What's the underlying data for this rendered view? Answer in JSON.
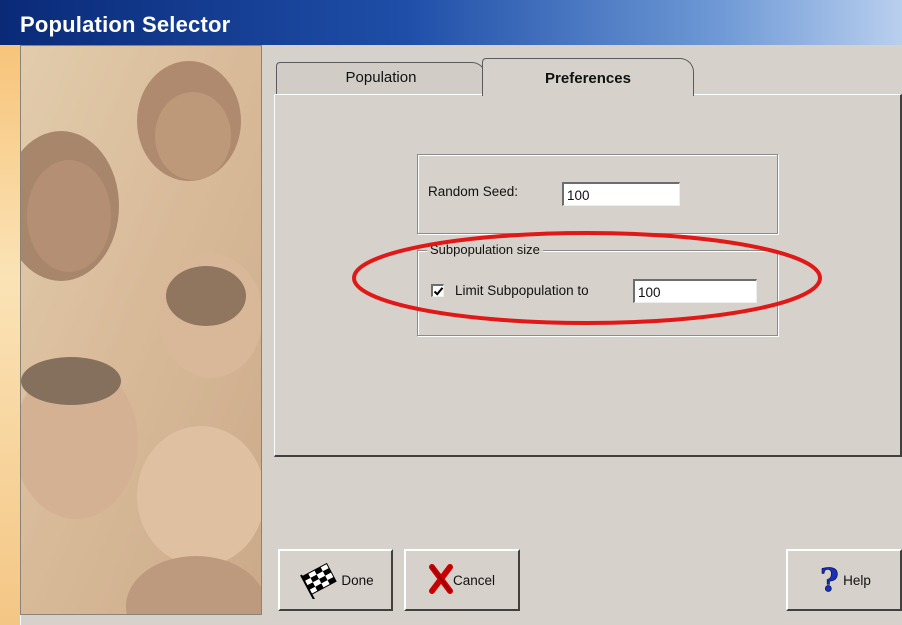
{
  "window": {
    "title": "Population Selector"
  },
  "tabs": [
    {
      "label": "Population",
      "active": false
    },
    {
      "label": "Preferences",
      "active": true
    }
  ],
  "preferences": {
    "random_seed_label": "Random Seed:",
    "random_seed_value": "100",
    "subpopulation_group_label": "Subpopulation size",
    "limit_checkbox_label": "Limit Subpopulation to",
    "limit_checkbox_checked": true,
    "limit_value": "100"
  },
  "buttons": {
    "done_label": "Done",
    "cancel_label": "Cancel",
    "help_label": "Help"
  },
  "icons": {
    "done": "checkered-flag-icon",
    "cancel": "red-x-icon",
    "help": "question-mark-icon",
    "check": "check-mark-icon"
  },
  "colors": {
    "title_bar_start": "#0a2a78",
    "title_bar_end": "#b9cfee",
    "highlight": "#e01818",
    "dialog_bg": "#d6d2cb"
  }
}
